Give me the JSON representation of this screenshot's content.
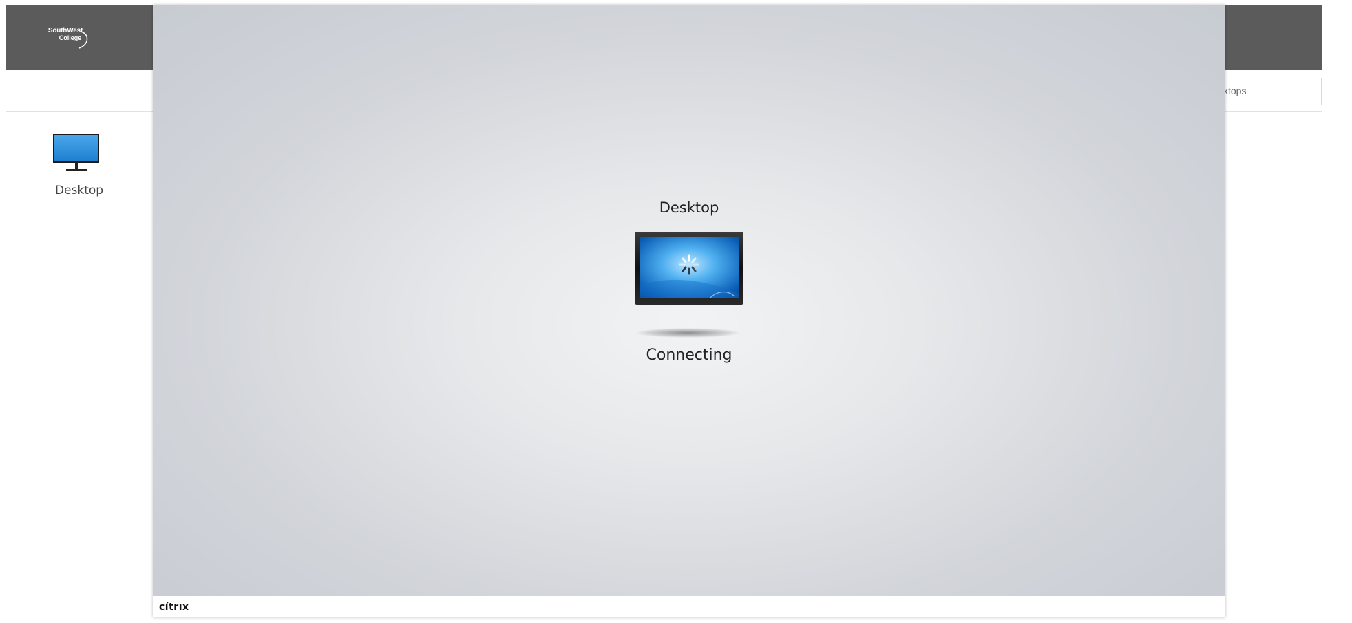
{
  "storefront": {
    "logo": {
      "line1": "SouthWest",
      "line2": "College"
    },
    "search": {
      "value": "sktops"
    },
    "apps": [
      {
        "label": "Desktop",
        "icon": "monitor-icon"
      }
    ]
  },
  "launch_dialog": {
    "title": "Desktop",
    "status": "Connecting",
    "icon": "monitor-loading-icon",
    "vendor_logo": "citrix"
  },
  "colors": {
    "topbar": "#5b5b5b",
    "dialog_center": "#f2f3f4",
    "dialog_edge": "#c7cbd2",
    "tile_blue": "#2b8fd8"
  }
}
